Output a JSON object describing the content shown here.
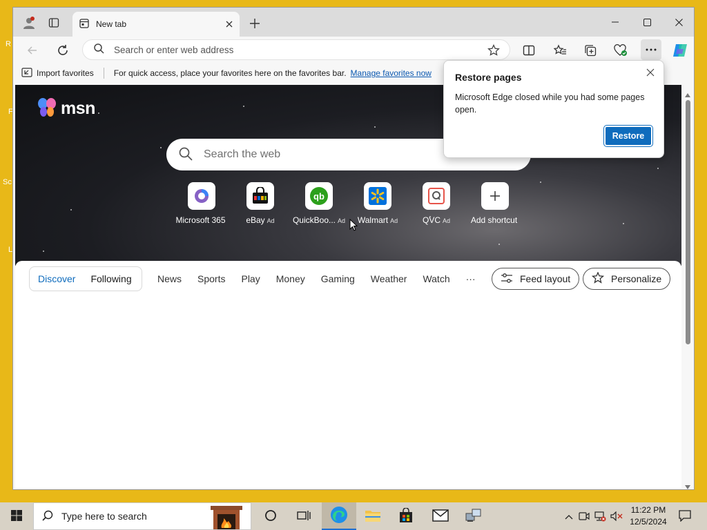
{
  "desktop": {
    "edge_letters": [
      "R",
      "F",
      "Sc",
      "L"
    ]
  },
  "window": {
    "tab_title": "New tab",
    "controls": [
      "minimize",
      "maximize",
      "close"
    ]
  },
  "toolbar": {
    "address_placeholder": "Search or enter web address"
  },
  "favorites_bar": {
    "import_label": "Import favorites",
    "message": "For quick access, place your favorites here on the favorites bar.",
    "manage_link": "Manage favorites now"
  },
  "msn": {
    "logo_text": "msn",
    "search_placeholder": "Search the web",
    "shortcuts": [
      {
        "label": "Microsoft 365",
        "ad": ""
      },
      {
        "label": "eBay",
        "ad": "Ad"
      },
      {
        "label": "QuickBoo...",
        "ad": "Ad"
      },
      {
        "label": "Walmart",
        "ad": "Ad"
      },
      {
        "label": "QVC",
        "ad": "Ad"
      },
      {
        "label": "Add shortcut",
        "ad": ""
      }
    ],
    "feed_tabs": {
      "discover": "Discover",
      "following": "Following"
    },
    "nav": [
      "News",
      "Sports",
      "Play",
      "Money",
      "Gaming",
      "Weather",
      "Watch",
      "···"
    ],
    "feed_layout": "Feed layout",
    "personalize": "Personalize"
  },
  "popup": {
    "title": "Restore pages",
    "message": "Microsoft Edge closed while you had some pages open.",
    "button": "Restore"
  },
  "taskbar": {
    "search_placeholder": "Type here to search",
    "time": "11:22 PM",
    "date": "12/5/2024"
  },
  "colors": {
    "accent": "#0f6cbd",
    "desktop": "#e8b818",
    "link": "#0a58b0"
  }
}
